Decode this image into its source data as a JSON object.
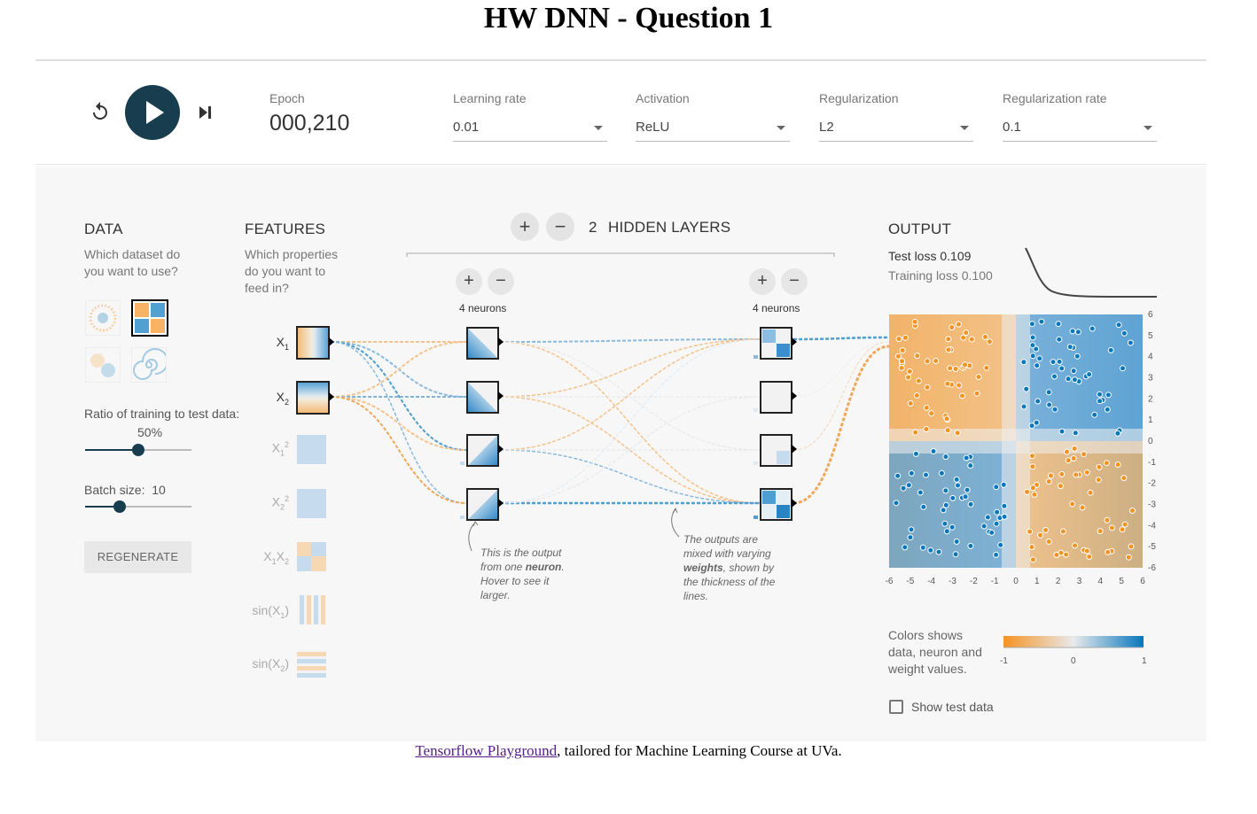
{
  "page": {
    "title": "HW DNN - Question 1",
    "footer_link": "Tensorflow Playground",
    "footer_text": ", tailored for Machine Learning Course at UVa."
  },
  "controls": {
    "epoch_label": "Epoch",
    "epoch_value": "000,210",
    "learning_rate_label": "Learning rate",
    "learning_rate_value": "0.01",
    "activation_label": "Activation",
    "activation_value": "ReLU",
    "regularization_label": "Regularization",
    "regularization_value": "L2",
    "reg_rate_label": "Regularization rate",
    "reg_rate_value": "0.1",
    "reset_icon": "reset-icon",
    "play_icon": "play-icon",
    "step_icon": "step-forward-icon"
  },
  "data_panel": {
    "heading": "DATA",
    "question": "Which dataset do you want to use?",
    "ratio_label": "Ratio of training to test data:",
    "ratio_value": "50%",
    "ratio_fraction": 0.5,
    "batch_label": "Batch size:",
    "batch_value": "10",
    "batch_fraction": 0.3,
    "regenerate": "REGENERATE"
  },
  "features": {
    "heading": "FEATURES",
    "question": "Which properties do you want to feed in?"
  },
  "network": {
    "layers_count": "2",
    "layers_label": "HIDDEN LAYERS",
    "layer1_neurons": "4 neurons",
    "layer2_neurons": "4 neurons",
    "note_neuron_pre": "This is the output from one ",
    "note_neuron_bold": "neuron",
    "note_neuron_post": ". Hover to see it larger.",
    "note_weights_pre": "The outputs are mixed with varying ",
    "note_weights_bold": "weights",
    "note_weights_post": ", shown by the thickness of the lines."
  },
  "output": {
    "heading": "OUTPUT",
    "test_loss_label": "Test loss",
    "test_loss_value": "0.109",
    "train_loss_label": "Training loss",
    "train_loss_value": "0.100",
    "colors_text": "Colors shows data, neuron and weight values.",
    "scale_min": "-1",
    "scale_mid": "0",
    "scale_max": "1",
    "show_test_label": "Show test data",
    "x_ticks": [
      "-6",
      "-5",
      "-4",
      "-3",
      "-2",
      "-1",
      "0",
      "1",
      "2",
      "3",
      "4",
      "5",
      "6"
    ],
    "y_ticks": [
      "6",
      "5",
      "4",
      "3",
      "2",
      "1",
      "0",
      "-1",
      "-2",
      "-3",
      "-4",
      "-5",
      "-6"
    ]
  },
  "colors": {
    "orange": "#f59322",
    "blue": "#0877bd",
    "dark": "#183d4e"
  }
}
